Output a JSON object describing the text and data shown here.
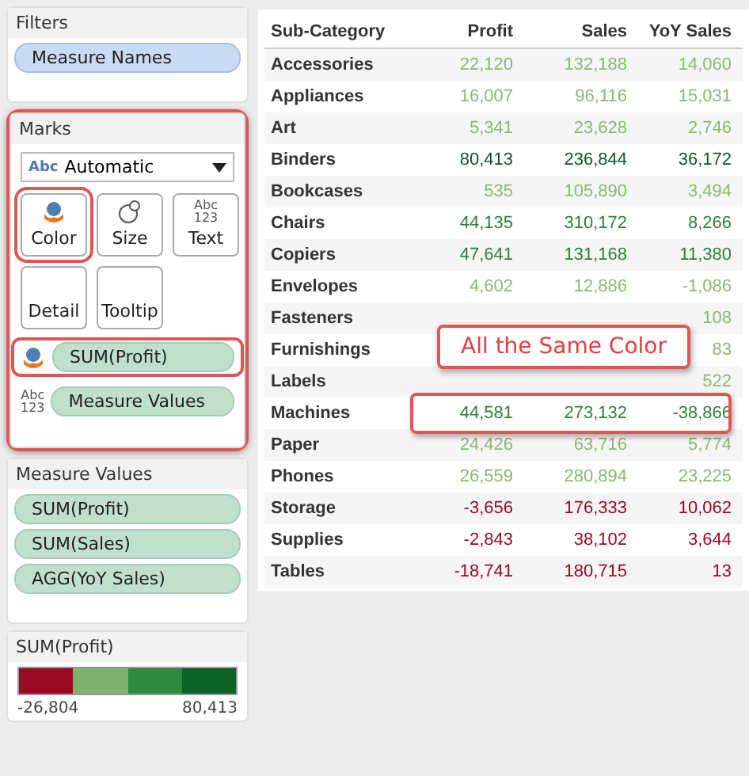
{
  "filters": {
    "title": "Filters",
    "pills": [
      "Measure Names"
    ]
  },
  "marks": {
    "title": "Marks",
    "mark_type": {
      "icon": "Abc",
      "label": "Automatic"
    },
    "cards": [
      {
        "kind": "color",
        "label": "Color",
        "highlighted": true
      },
      {
        "kind": "size",
        "label": "Size",
        "highlighted": false
      },
      {
        "kind": "text",
        "label": "Text",
        "icon_text": [
          "Abc",
          "123"
        ],
        "highlighted": false
      },
      {
        "kind": "plain",
        "label": "Detail",
        "highlighted": false
      },
      {
        "kind": "plain",
        "label": "Tooltip",
        "highlighted": false
      }
    ],
    "fields": [
      {
        "kind": "color",
        "label": "SUM(Profit)",
        "highlighted": true
      },
      {
        "kind": "text",
        "icon_text": [
          "Abc",
          "123"
        ],
        "label": "Measure Values",
        "highlighted": false
      }
    ]
  },
  "measure_values": {
    "title": "Measure Values",
    "pills": [
      "SUM(Profit)",
      "SUM(Sales)",
      "AGG(YoY Sales)"
    ]
  },
  "legend": {
    "title": "SUM(Profit)",
    "steps": [
      {
        "color": "#9b0a24"
      },
      {
        "color": "#7fb26f"
      },
      {
        "color": "#2d8a3e"
      },
      {
        "color": "#0b6328"
      }
    ],
    "min": "-26,804",
    "max": "80,413"
  },
  "table": {
    "columns": [
      "Sub-Category",
      "Profit",
      "Sales",
      "YoY Sales"
    ],
    "rows": [
      {
        "name": "Accessories",
        "values": [
          "22,120",
          "132,188",
          "14,060"
        ],
        "color": "#8db870"
      },
      {
        "name": "Appliances",
        "values": [
          "16,007",
          "96,116",
          "15,031"
        ],
        "color": "#8db870"
      },
      {
        "name": "Art",
        "values": [
          "5,341",
          "23,628",
          "2,746"
        ],
        "color": "#8db870"
      },
      {
        "name": "Binders",
        "values": [
          "80,413",
          "236,844",
          "36,172"
        ],
        "color": "#0b5a26"
      },
      {
        "name": "Bookcases",
        "values": [
          "535",
          "105,890",
          "3,494"
        ],
        "color": "#8db870"
      },
      {
        "name": "Chairs",
        "values": [
          "44,135",
          "310,172",
          "8,266"
        ],
        "color": "#2d7f3c"
      },
      {
        "name": "Copiers",
        "values": [
          "47,641",
          "131,168",
          "11,380"
        ],
        "color": "#2d7f3c"
      },
      {
        "name": "Envelopes",
        "values": [
          "4,602",
          "12,886",
          "-1,086"
        ],
        "color": "#8db870"
      },
      {
        "name": "Fasteners",
        "values": [
          "108"
        ],
        "color": "#8db870"
      },
      {
        "name": "Furnishings",
        "values": [
          "83"
        ],
        "color": "#8db870"
      },
      {
        "name": "Labels",
        "values": [
          "522"
        ],
        "color": "#8db870"
      },
      {
        "name": "Machines",
        "values": [
          "44,581",
          "273,132",
          "-38,866"
        ],
        "color": "#2d7f3c",
        "highlighted": true
      },
      {
        "name": "Paper",
        "values": [
          "24,426",
          "63,716",
          "5,774"
        ],
        "color": "#8db870"
      },
      {
        "name": "Phones",
        "values": [
          "26,559",
          "280,894",
          "23,225"
        ],
        "color": "#8db870"
      },
      {
        "name": "Storage",
        "values": [
          "-3,656",
          "176,333",
          "10,062"
        ],
        "color": "#9b0a24"
      },
      {
        "name": "Supplies",
        "values": [
          "-2,843",
          "38,102",
          "3,644"
        ],
        "color": "#9b0a24"
      },
      {
        "name": "Tables",
        "values": [
          "-18,741",
          "180,715",
          "13"
        ],
        "color": "#9b0a24"
      }
    ]
  },
  "callout": {
    "text": "All the Same Color"
  }
}
